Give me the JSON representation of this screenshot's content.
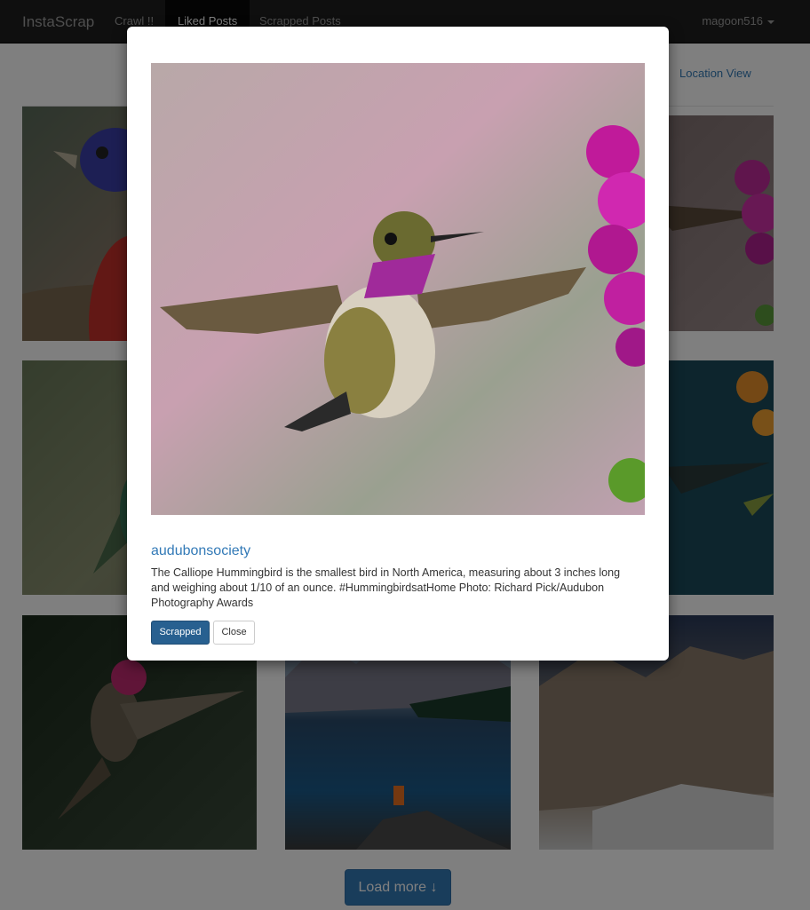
{
  "navbar": {
    "brand": "InstaScrap",
    "items": [
      {
        "label": "Crawl !!"
      },
      {
        "label": "Liked Posts"
      },
      {
        "label": "Scrapped Posts"
      }
    ],
    "user": "magoon516"
  },
  "page": {
    "location_view_label": "Location View",
    "load_more_label": "Load more ↓"
  },
  "grid": [
    {
      "subject": "painted-bunting"
    },
    {
      "subject": "hummingbird-flowers"
    },
    {
      "subject": "green-bird"
    },
    {
      "subject": "hummingbird-orange-flower"
    },
    {
      "subject": "annas-hummingbird"
    },
    {
      "subject": "moraine-lake"
    },
    {
      "subject": "snowy-mountains"
    }
  ],
  "modal": {
    "owner": "audubonsociety",
    "caption": "The Calliope Hummingbird is the smallest bird in North America, measuring about 3 inches long and weighing about 1/10 of an ounce. #HummingbirdsatHome Photo: Richard Pick/Audubon Photography Awards",
    "scrapped_label": "Scrapped",
    "close_label": "Close"
  }
}
